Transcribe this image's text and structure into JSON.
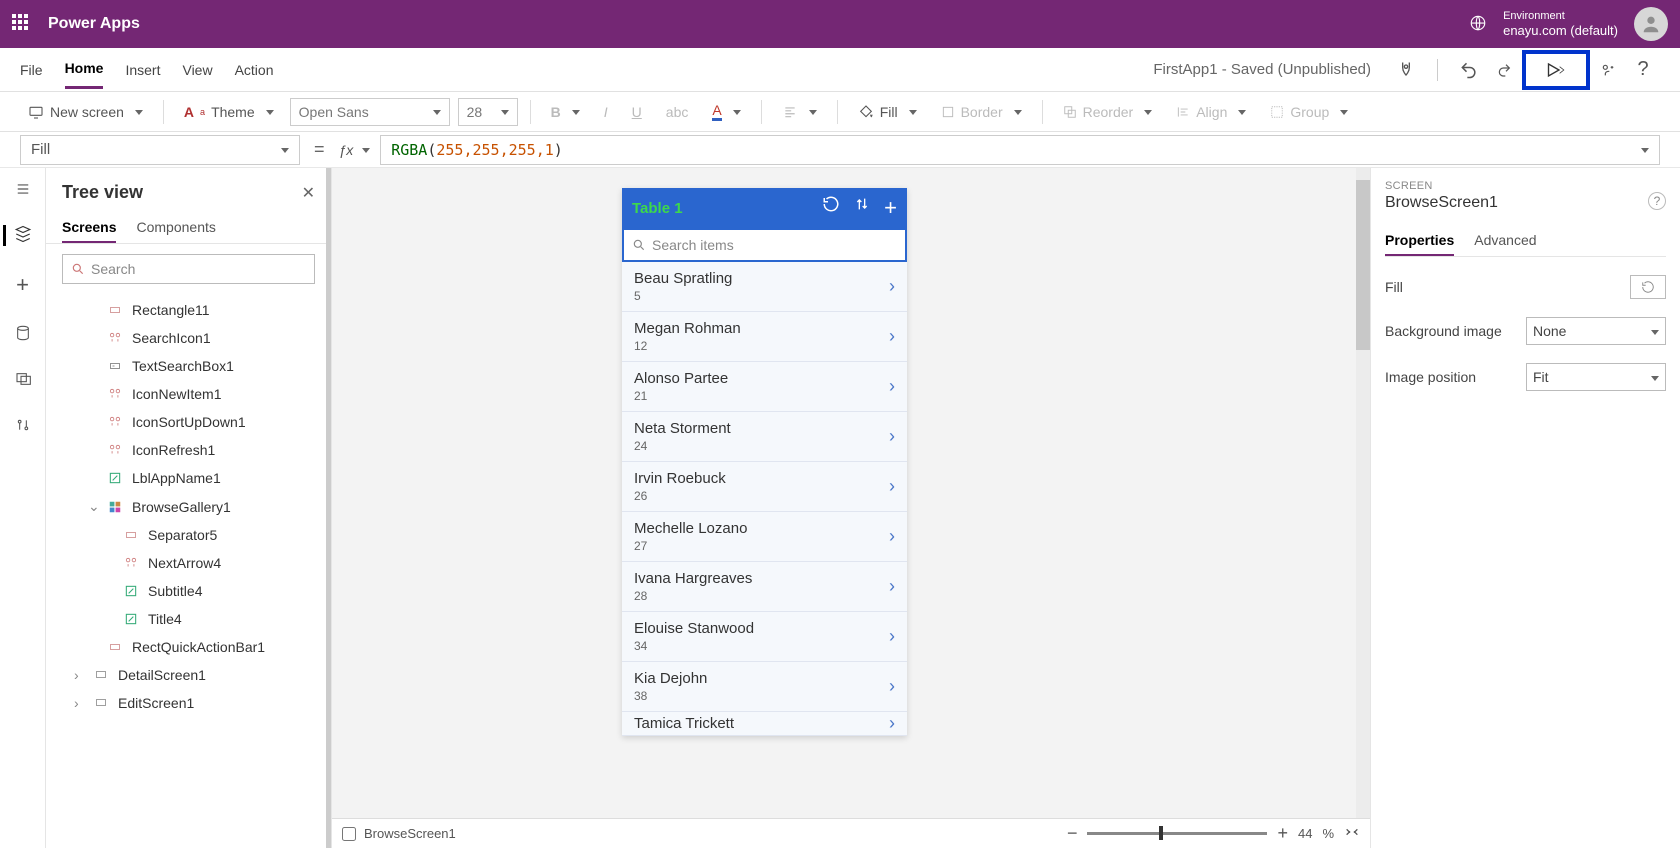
{
  "topbar": {
    "brand": "Power Apps",
    "env_label": "Environment",
    "env_value": "enayu.com (default)"
  },
  "menubar": {
    "tabs": [
      "File",
      "Home",
      "Insert",
      "View",
      "Action"
    ],
    "active": "Home",
    "doc_status": "FirstApp1 - Saved (Unpublished)"
  },
  "ribbon": {
    "new_screen": "New screen",
    "theme": "Theme",
    "font_family": "Open Sans",
    "font_size": "28",
    "fill": "Fill",
    "border": "Border",
    "reorder": "Reorder",
    "align": "Align",
    "group": "Group"
  },
  "formula": {
    "property": "Fill",
    "text_fn": "RGBA",
    "args": [
      "255",
      "255",
      "255",
      "1"
    ]
  },
  "tree": {
    "title": "Tree view",
    "tabs": [
      "Screens",
      "Components"
    ],
    "active": "Screens",
    "search_placeholder": "Search",
    "items": [
      {
        "name": "Rectangle11",
        "icon": "shape",
        "indent": 1
      },
      {
        "name": "SearchIcon1",
        "icon": "ctrl",
        "indent": 1
      },
      {
        "name": "TextSearchBox1",
        "icon": "ctrl2",
        "indent": 1
      },
      {
        "name": "IconNewItem1",
        "icon": "ctrl",
        "indent": 1
      },
      {
        "name": "IconSortUpDown1",
        "icon": "ctrl",
        "indent": 1
      },
      {
        "name": "IconRefresh1",
        "icon": "ctrl",
        "indent": 1
      },
      {
        "name": "LblAppName1",
        "icon": "label",
        "indent": 1
      },
      {
        "name": "BrowseGallery1",
        "icon": "gallery",
        "indent": 1,
        "expanded": true
      },
      {
        "name": "Separator5",
        "icon": "shape",
        "indent": 2
      },
      {
        "name": "NextArrow4",
        "icon": "ctrl",
        "indent": 2
      },
      {
        "name": "Subtitle4",
        "icon": "label",
        "indent": 2
      },
      {
        "name": "Title4",
        "icon": "label",
        "indent": 2
      },
      {
        "name": "RectQuickActionBar1",
        "icon": "shape",
        "indent": 1
      },
      {
        "name": "DetailScreen1",
        "icon": "screen",
        "indent": 0,
        "expander": ">"
      },
      {
        "name": "EditScreen1",
        "icon": "screen",
        "indent": 0,
        "expander": ">"
      }
    ]
  },
  "app": {
    "title": "Table 1",
    "search_placeholder": "Search items",
    "rows": [
      {
        "name": "Beau Spratling",
        "sub": "5"
      },
      {
        "name": "Megan Rohman",
        "sub": "12"
      },
      {
        "name": "Alonso Partee",
        "sub": "21"
      },
      {
        "name": "Neta Storment",
        "sub": "24"
      },
      {
        "name": "Irvin Roebuck",
        "sub": "26"
      },
      {
        "name": "Mechelle Lozano",
        "sub": "27"
      },
      {
        "name": "Ivana Hargreaves",
        "sub": "28"
      },
      {
        "name": "Elouise Stanwood",
        "sub": "34"
      },
      {
        "name": "Kia Dejohn",
        "sub": "38"
      },
      {
        "name": "Tamica Trickett",
        "sub": ""
      }
    ]
  },
  "statusbar": {
    "selected": "BrowseScreen1",
    "zoom": "44",
    "zoom_unit": "%"
  },
  "props": {
    "caption": "SCREEN",
    "name": "BrowseScreen1",
    "tabs": [
      "Properties",
      "Advanced"
    ],
    "active": "Properties",
    "fill_label": "Fill",
    "bgimg_label": "Background image",
    "bgimg_value": "None",
    "imgpos_label": "Image position",
    "imgpos_value": "Fit"
  }
}
